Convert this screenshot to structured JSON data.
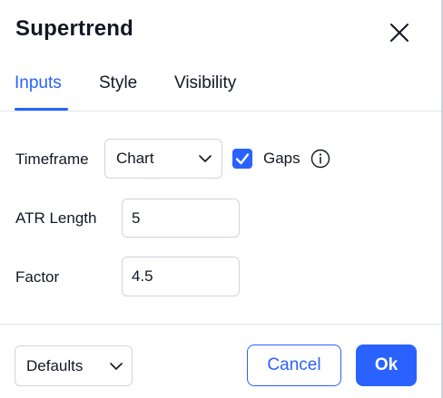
{
  "dialog": {
    "title": "Supertrend",
    "close_icon": "close-icon"
  },
  "tabs": [
    {
      "label": "Inputs",
      "active": true
    },
    {
      "label": "Style",
      "active": false
    },
    {
      "label": "Visibility",
      "active": false
    }
  ],
  "inputs": {
    "timeframe": {
      "label": "Timeframe",
      "selected": "Chart"
    },
    "gaps": {
      "label": "Gaps",
      "checked": true
    },
    "atr_length": {
      "label": "ATR Length",
      "value": "5"
    },
    "factor": {
      "label": "Factor",
      "value": "4.5"
    }
  },
  "footer": {
    "defaults_label": "Defaults",
    "cancel_label": "Cancel",
    "ok_label": "Ok"
  },
  "colors": {
    "accent": "#2962ff",
    "text": "#131722",
    "border": "#d1d4dc"
  }
}
